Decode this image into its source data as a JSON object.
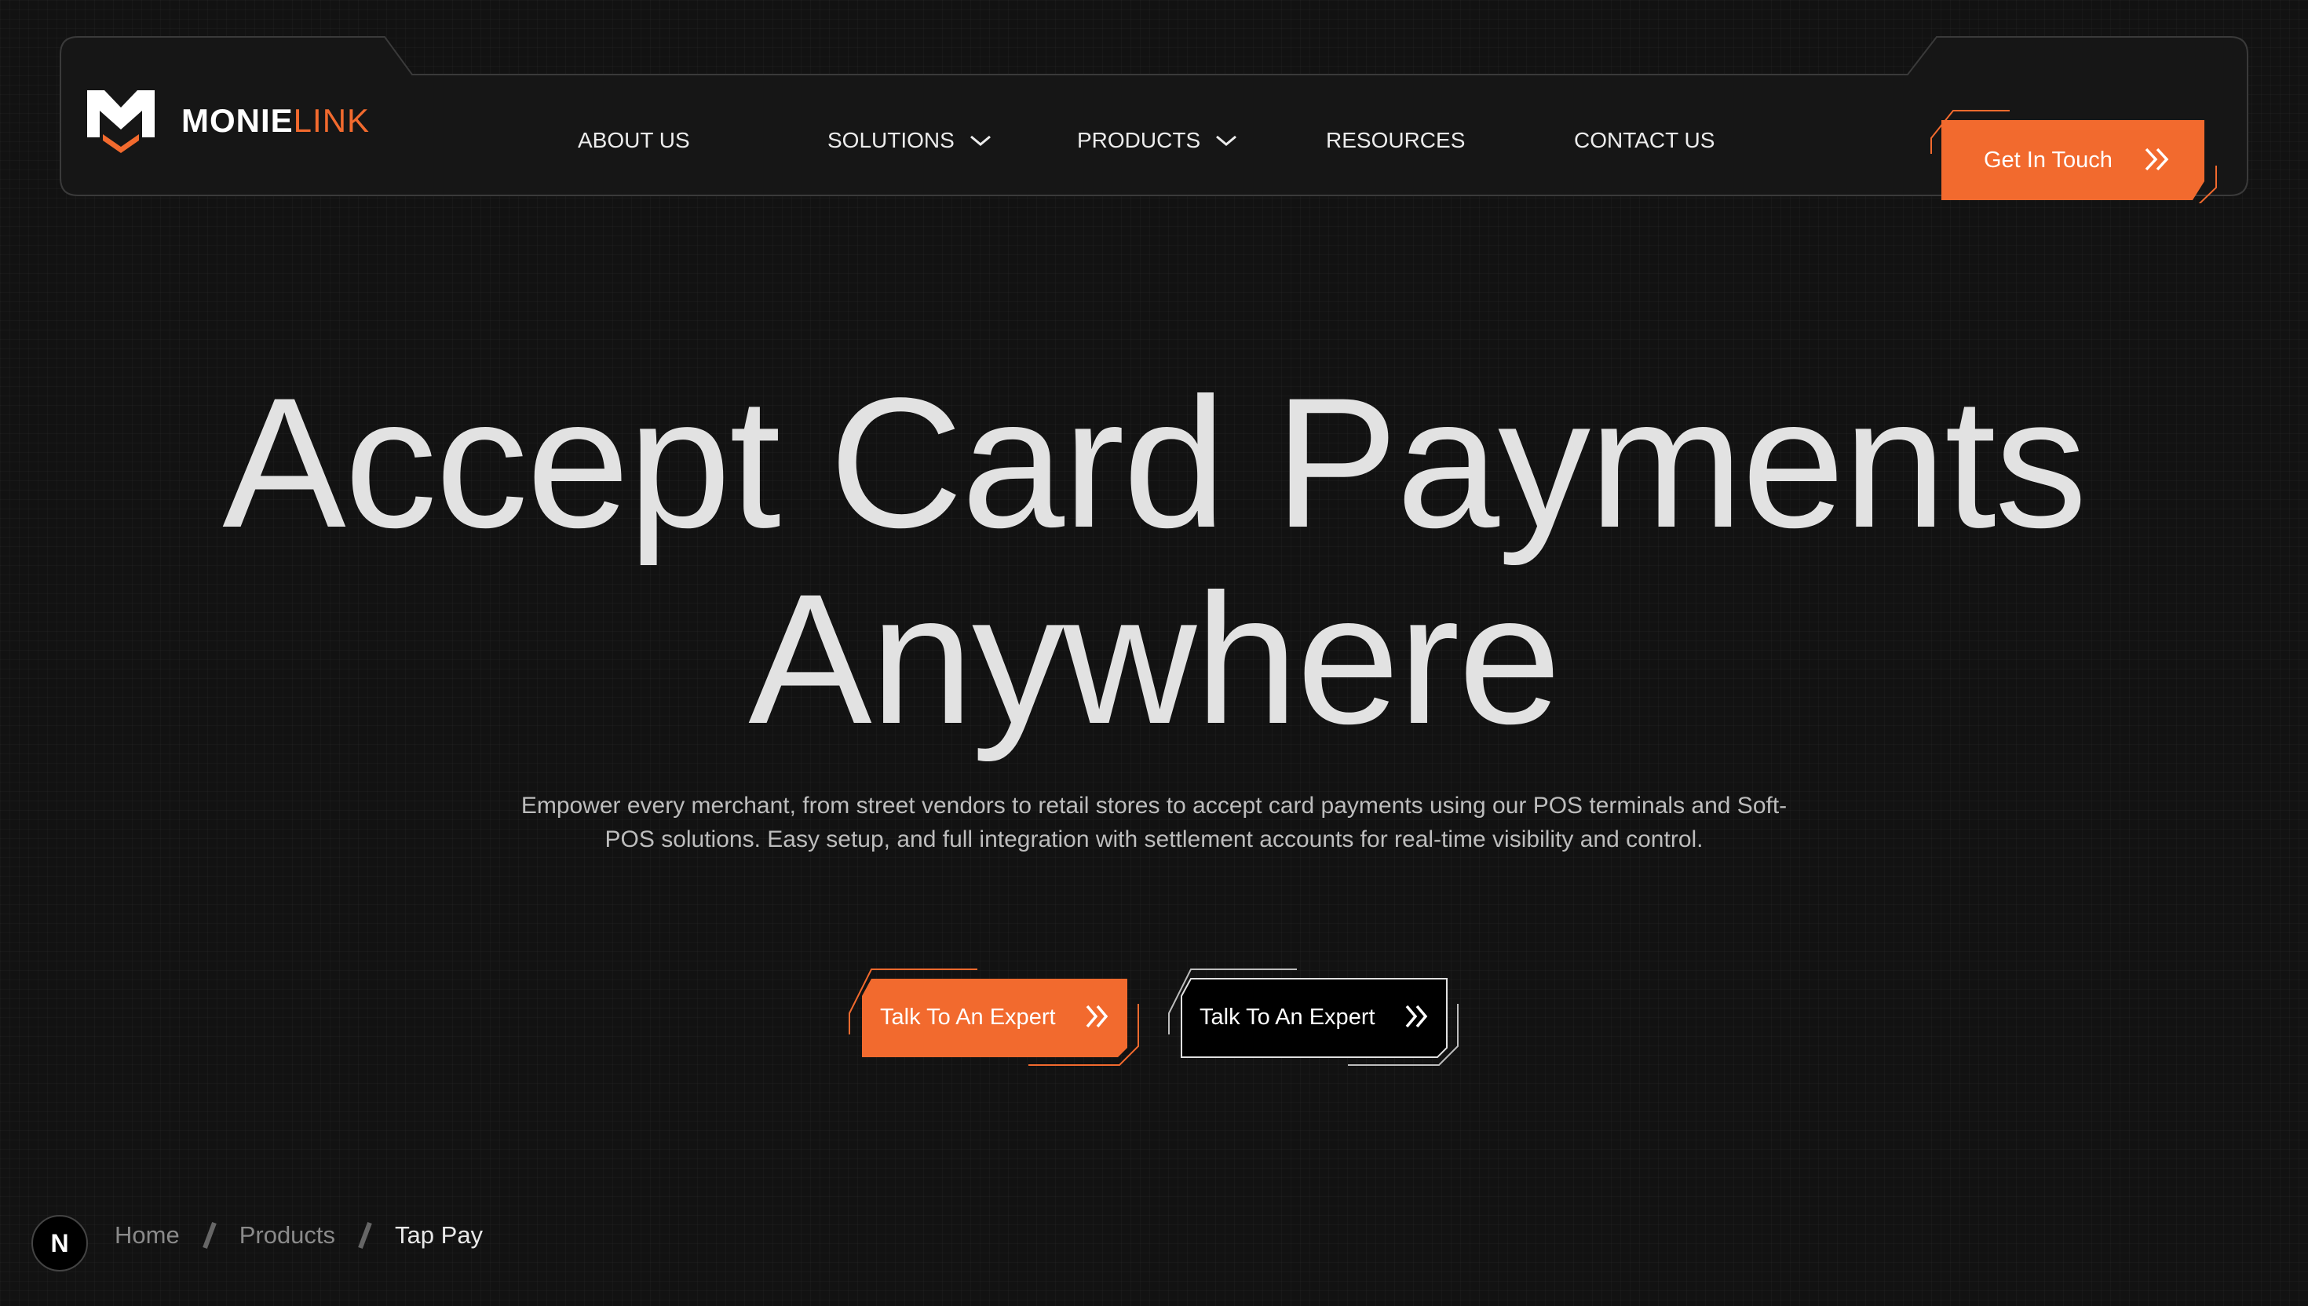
{
  "brand": {
    "part1": "MONIE",
    "part2": "LINK"
  },
  "nav": {
    "items": [
      {
        "label": "ABOUT US",
        "has_dropdown": false
      },
      {
        "label": "SOLUTIONS",
        "has_dropdown": true
      },
      {
        "label": "PRODUCTS",
        "has_dropdown": true
      },
      {
        "label": "RESOURCES",
        "has_dropdown": false
      },
      {
        "label": "CONTACT US",
        "has_dropdown": false
      }
    ],
    "cta_label": "Get In Touch"
  },
  "hero": {
    "title_line1": "Accept Card Payments",
    "title_line2": "Anywhere",
    "subtitle": "Empower every merchant, from street vendors to retail stores to accept card payments using our POS terminals and Soft-POS solutions. Easy setup, and full integration with settlement accounts for real-time visibility and control.",
    "primary_button": "Talk To An Expert",
    "secondary_button": "Talk To An Expert"
  },
  "breadcrumb": {
    "badge": "N",
    "items": [
      "Home",
      "Products",
      "Tap Pay"
    ]
  },
  "colors": {
    "accent": "#f26a2e",
    "background": "#121212",
    "nav_bg": "#161616"
  }
}
